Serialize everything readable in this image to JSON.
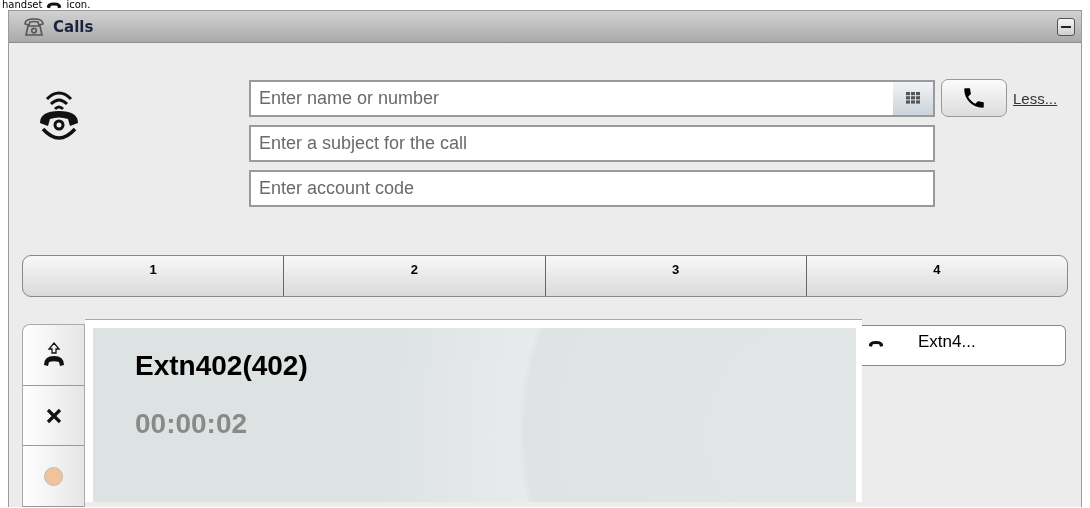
{
  "caption": {
    "before": "handset",
    "after": "icon."
  },
  "window": {
    "title": "Calls"
  },
  "dial": {
    "number_placeholder": "Enter name or number",
    "subject_placeholder": "Enter a subject for the call",
    "account_placeholder": "Enter account code",
    "less_link": "Less..."
  },
  "call_tabs": [
    {
      "label": "1"
    },
    {
      "label": "2"
    },
    {
      "label": "3"
    },
    {
      "label": "4"
    }
  ],
  "active_call": {
    "name": "Extn402(402)",
    "duration": "00:00:02"
  },
  "call_list": [
    {
      "label": "Extn4..."
    }
  ]
}
